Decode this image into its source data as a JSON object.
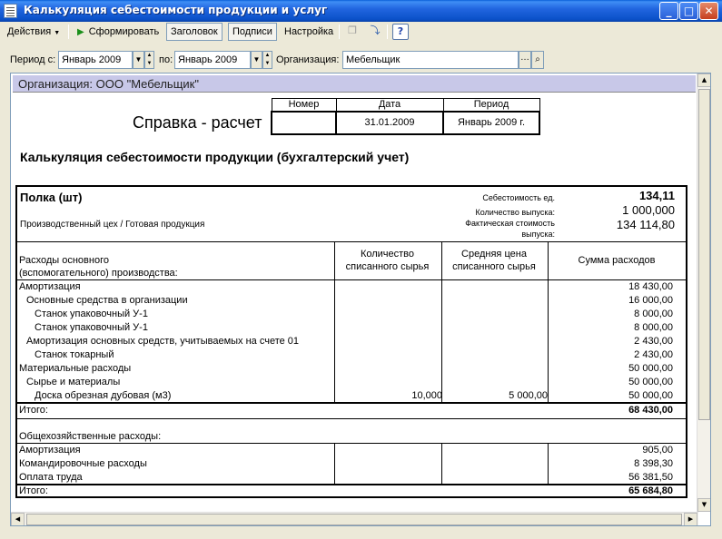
{
  "window": {
    "title": "Калькуляция себестоимости продукции и услуг"
  },
  "toolbar": {
    "actions": "Действия",
    "generate": "Сформировать",
    "header": "Заголовок",
    "signatures": "Подписи",
    "settings": "Настройка"
  },
  "filters": {
    "period_from_label": "Период с:",
    "period_from": "Январь 2009",
    "period_to_label": "по:",
    "period_to": "Январь 2009",
    "org_label": "Организация:",
    "org_value": "Мебельщик"
  },
  "report": {
    "org_line": "Организация: ООО \"Мебельщик\"",
    "doc_title": "Справка - расчет",
    "hdr_number": "Номер",
    "hdr_date": "Дата",
    "hdr_period": "Период",
    "val_number": "",
    "val_date": "31.01.2009",
    "val_period": "Январь 2009 г.",
    "title": "Калькуляция себестоимости продукции (бухгалтерский учет)",
    "product": "Полка (шт)",
    "product_sub": "Производственный цех / Готовая продукция",
    "unit_cost_label": "Себестоимость ед.",
    "unit_cost": "134,11",
    "qty_label": "Количество выпуска:",
    "qty": "1 000,000",
    "actual_label": "Фактическая стоимость",
    "actual_label2": "выпуска:",
    "actual": "134 114,80",
    "col1a": "Расходы основного",
    "col1b": "(вспомогательного) производства:",
    "col2a": "Количество",
    "col2b": "списанного сырья",
    "col3a": "Средняя цена",
    "col3b": "списанного сырья",
    "col4": "Сумма расходов",
    "rows": [
      {
        "name": "Амортизация",
        "qty": "",
        "price": "",
        "sum": "18 430,00"
      },
      {
        "name": "Основные средства в организации",
        "qty": "",
        "price": "",
        "sum": "16 000,00"
      },
      {
        "name": "Станок упаковочный У-1",
        "qty": "",
        "price": "",
        "sum": "8 000,00"
      },
      {
        "name": "Станок упаковочный У-1",
        "qty": "",
        "price": "",
        "sum": "8 000,00"
      },
      {
        "name": "Амортизация основных средств, учитываемых на счете 01",
        "qty": "",
        "price": "",
        "sum": "2 430,00"
      },
      {
        "name": "Станок токарный",
        "qty": "",
        "price": "",
        "sum": "2 430,00"
      },
      {
        "name": "Материальные расходы",
        "qty": "",
        "price": "",
        "sum": "50 000,00"
      },
      {
        "name": "Сырье и материалы",
        "qty": "",
        "price": "",
        "sum": "50 000,00"
      },
      {
        "name": "Доска обрезная дубовая (м3)",
        "qty": "10,000",
        "price": "5 000,00",
        "sum": "50 000,00"
      }
    ],
    "total1_label": "Итого:",
    "total1": "68 430,00",
    "general_label": "Общехозяйственные расходы:",
    "rows2": [
      {
        "name": "Амортизация",
        "sum": "905,00"
      },
      {
        "name": "Командировочные расходы",
        "sum": "8 398,30"
      },
      {
        "name": "Оплата труда",
        "sum": "56 381,50"
      }
    ],
    "total2_label": "Итого:",
    "total2": "65 684,80"
  }
}
